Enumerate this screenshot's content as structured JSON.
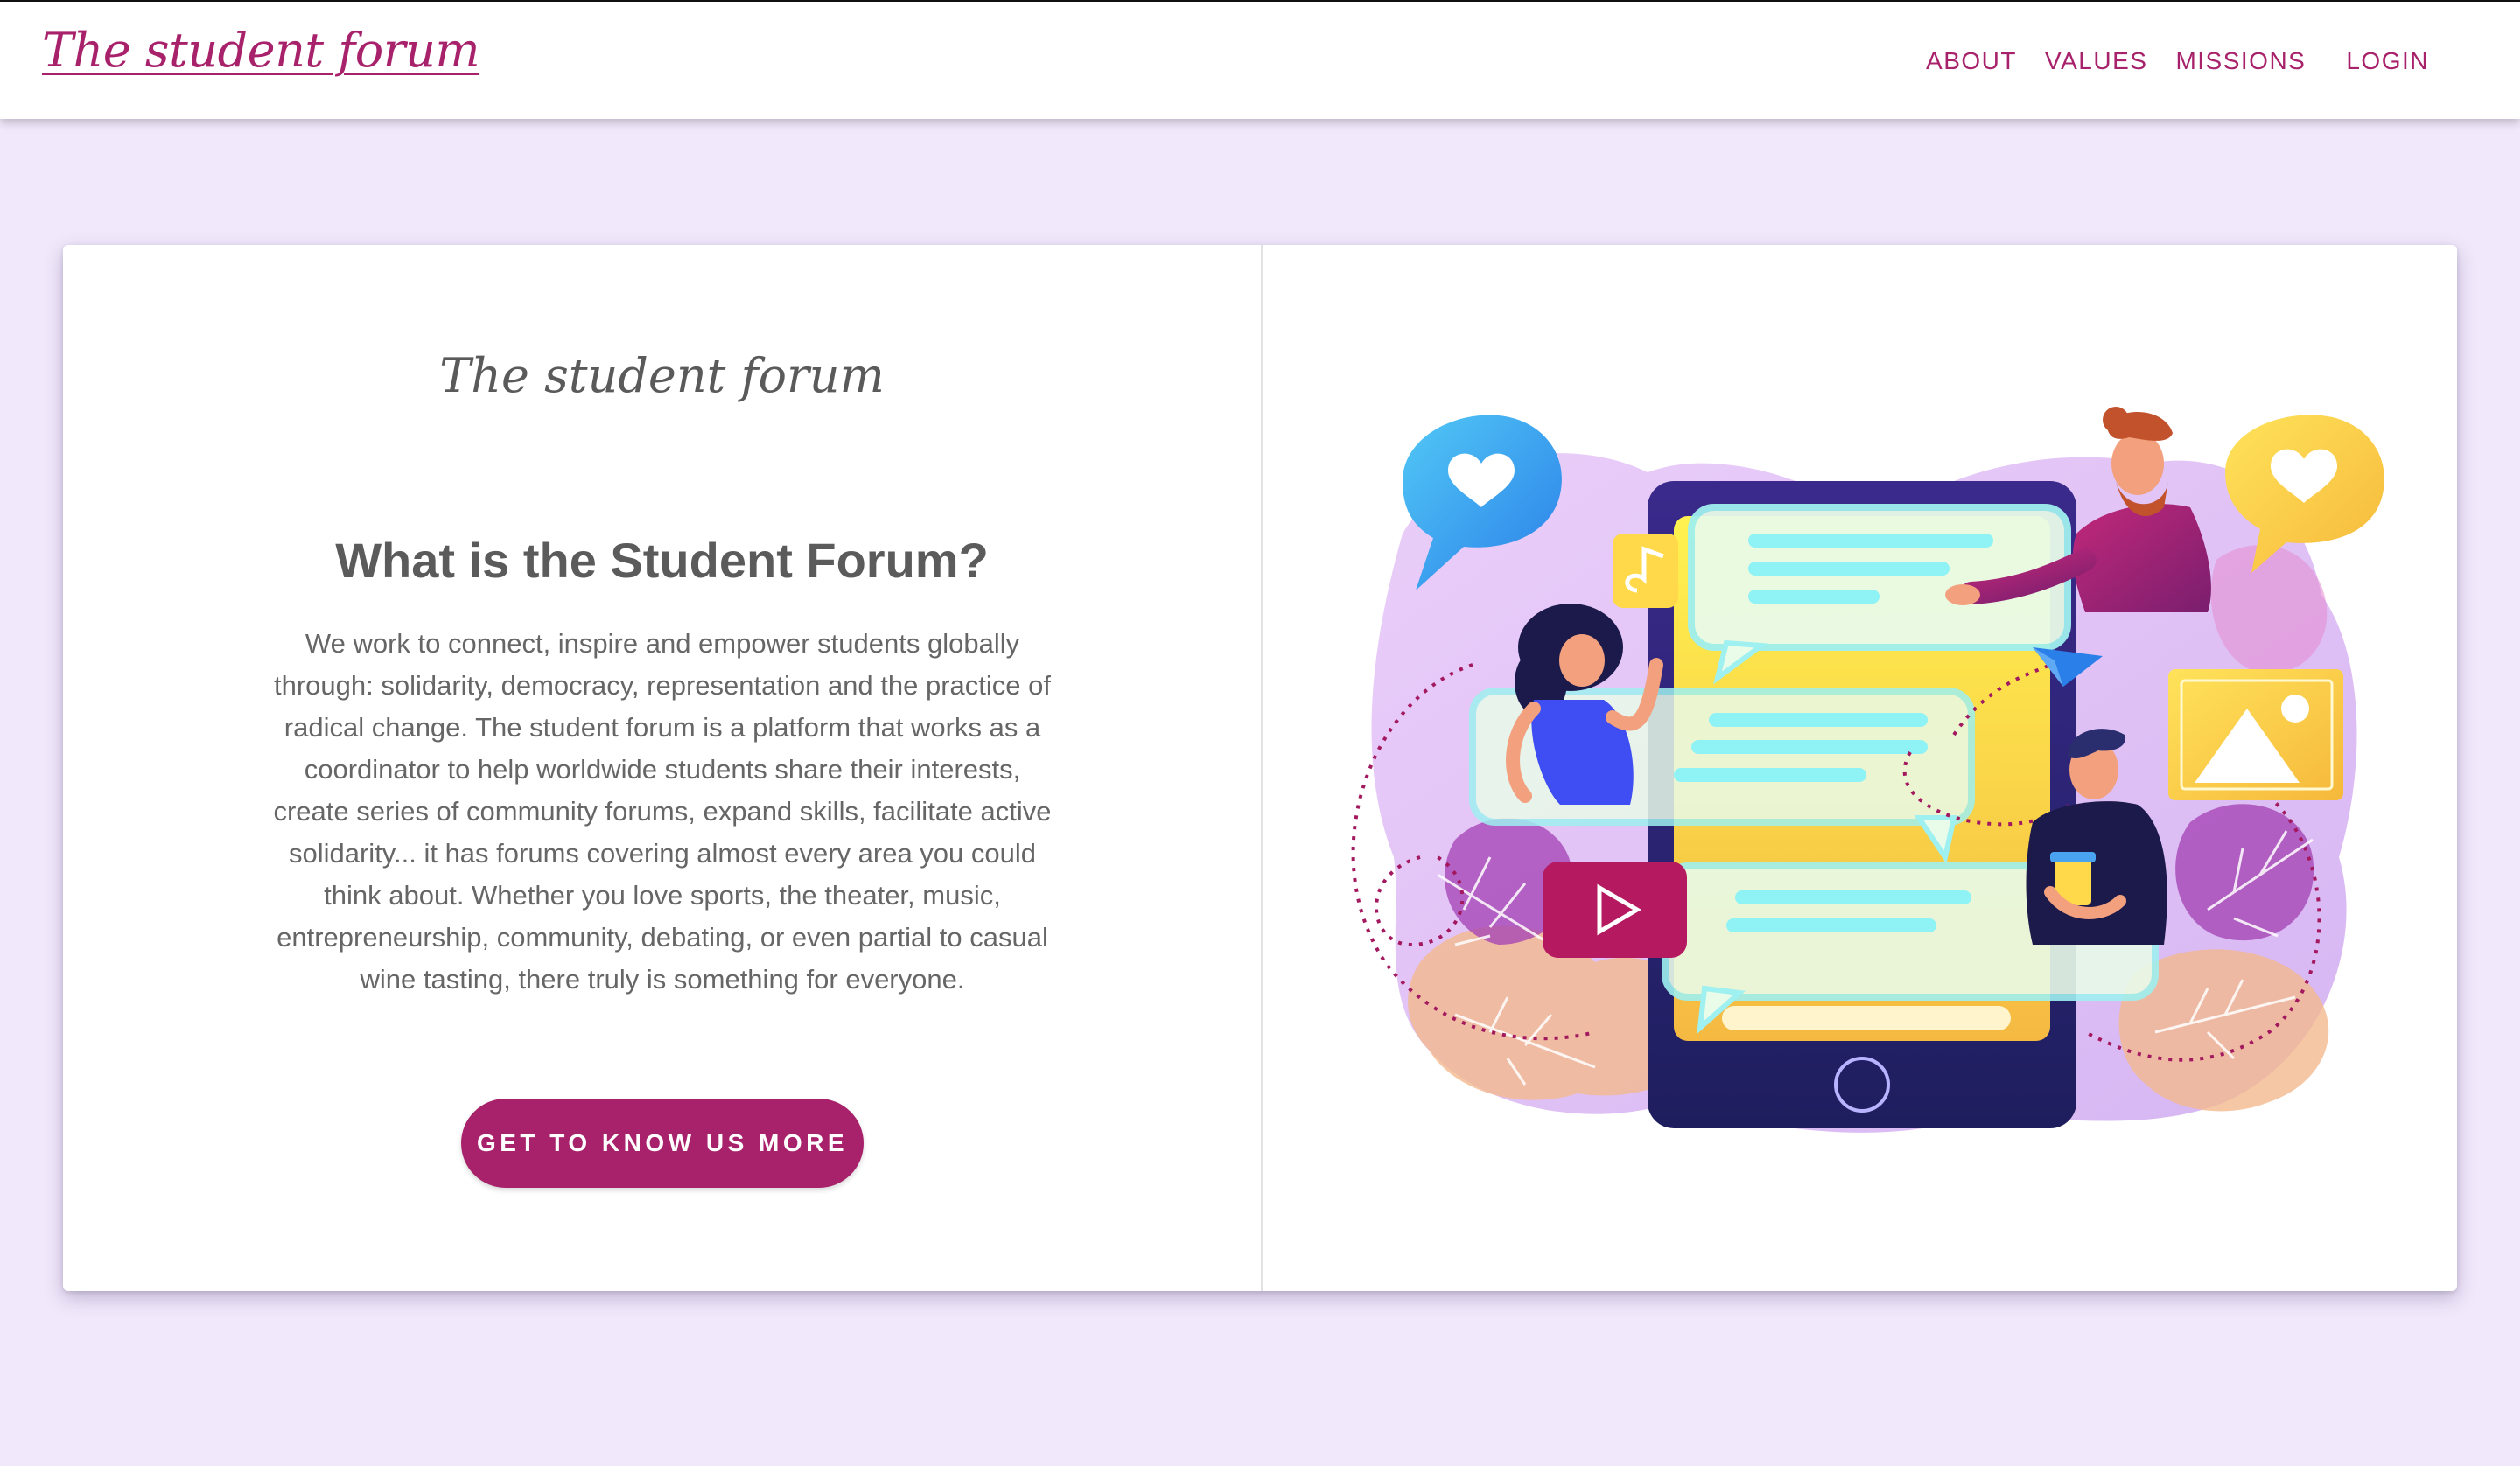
{
  "header": {
    "brand": "The student forum",
    "nav": {
      "about": "ABOUT",
      "values": "VALUES",
      "missions": "MISSIONS",
      "login": "LOGIN"
    }
  },
  "hero": {
    "logo_text": "The student forum",
    "heading": "What is the Student Forum?",
    "body": "We work to connect, inspire and empower students globally through: solidarity, democracy, representation and the practice of radical change. The student forum is a platform that works as a coordinator to help worldwide students share their interests, create series of community forums, expand skills, facilitate active solidarity... it has forums covering almost every area you could think about. Whether you love sports, the theater, music, entrepreneurship, community, debating, or even partial to casual wine tasting, there truly is something for everyone.",
    "cta_label": "GET TO KNOW US MORE"
  },
  "colors": {
    "accent": "#a8226b",
    "page_background": "#f1e8fb",
    "card_background": "#ffffff",
    "text_gray": "#666666"
  },
  "illustration": {
    "icons": [
      "heart-bubble-icon",
      "music-note-icon",
      "paper-plane-icon",
      "image-icon",
      "play-button-icon",
      "smartphone"
    ]
  }
}
